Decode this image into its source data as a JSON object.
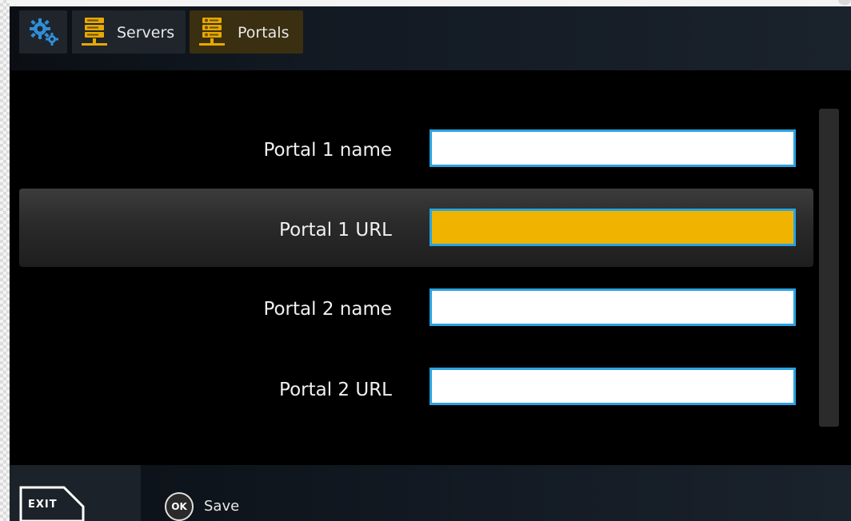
{
  "topbar": {
    "settings_icon": "gears-icon",
    "servers_label": "Servers",
    "servers_icon": "server-icon",
    "portals_label": "Portals",
    "portals_icon": "portal-server-icon"
  },
  "fields": [
    {
      "label": "Portal 1 name",
      "value": "",
      "focused": false
    },
    {
      "label": "Portal 1 URL",
      "value": "",
      "focused": true
    },
    {
      "label": "Portal 2 name",
      "value": "",
      "focused": false
    },
    {
      "label": "Portal 2 URL",
      "value": "",
      "focused": false
    }
  ],
  "bottombar": {
    "exit_label": "EXIT",
    "ok_label": "OK",
    "save_label": "Save"
  },
  "colors": {
    "accent_gold": "#f0b400",
    "input_border": "#29a3e0",
    "icon_blue": "#2f8fd8",
    "icon_gold": "#e8a800"
  }
}
